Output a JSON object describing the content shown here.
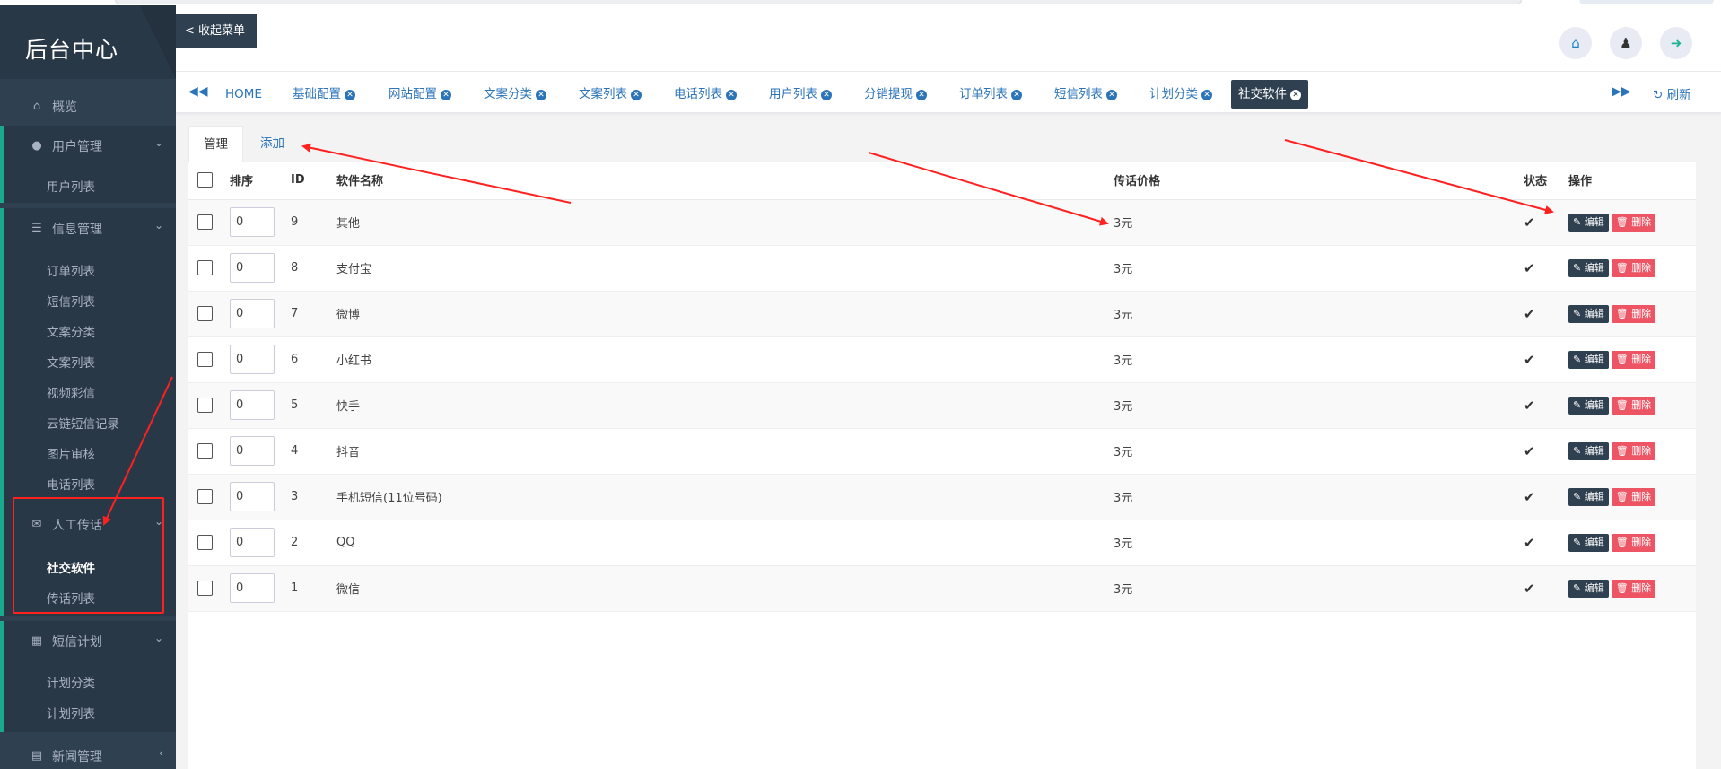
{
  "app": {
    "logo": "后台中心",
    "collapse_label": "< 收起菜单"
  },
  "sidebar": {
    "overview": "概览",
    "user_mgmt": {
      "label": "用户管理",
      "items": [
        "用户列表"
      ]
    },
    "info_mgmt": {
      "label": "信息管理",
      "items": [
        "订单列表",
        "短信列表",
        "文案分类",
        "文案列表",
        "视频彩信",
        "云链短信记录",
        "图片审核",
        "电话列表"
      ]
    },
    "manual": {
      "label": "人工传话",
      "items": [
        "社交软件",
        "传话列表"
      ],
      "active_item": "社交软件"
    },
    "sms_plan": {
      "label": "短信计划",
      "items": [
        "计划分类",
        "计划列表"
      ]
    },
    "news": {
      "label": "新闻管理"
    }
  },
  "tabs": [
    {
      "label": "HOME",
      "closable": false
    },
    {
      "label": "基础配置",
      "closable": true
    },
    {
      "label": "网站配置",
      "closable": true
    },
    {
      "label": "文案分类",
      "closable": true
    },
    {
      "label": "文案列表",
      "closable": true
    },
    {
      "label": "电话列表",
      "closable": true
    },
    {
      "label": "用户列表",
      "closable": true
    },
    {
      "label": "分销提现",
      "closable": true
    },
    {
      "label": "订单列表",
      "closable": true
    },
    {
      "label": "短信列表",
      "closable": true
    },
    {
      "label": "计划分类",
      "closable": true
    },
    {
      "label": "社交软件",
      "closable": true,
      "active": true
    }
  ],
  "tabs_refresh": "刷新",
  "subtabs": {
    "manage": "管理",
    "add": "添加"
  },
  "table": {
    "headers": {
      "sort": "排序",
      "id": "ID",
      "name": "软件名称",
      "price": "传话价格",
      "status": "状态",
      "ops": "操作"
    },
    "rows": [
      {
        "sort": "0",
        "id": "9",
        "name": "其他",
        "price": "3元"
      },
      {
        "sort": "0",
        "id": "8",
        "name": "支付宝",
        "price": "3元"
      },
      {
        "sort": "0",
        "id": "7",
        "name": "微博",
        "price": "3元"
      },
      {
        "sort": "0",
        "id": "6",
        "name": "小红书",
        "price": "3元"
      },
      {
        "sort": "0",
        "id": "5",
        "name": "快手",
        "price": "3元"
      },
      {
        "sort": "0",
        "id": "4",
        "name": "抖音",
        "price": "3元"
      },
      {
        "sort": "0",
        "id": "3",
        "name": "手机短信(11位号码)",
        "price": "3元"
      },
      {
        "sort": "0",
        "id": "2",
        "name": "QQ",
        "price": "3元"
      },
      {
        "sort": "0",
        "id": "1",
        "name": "微信",
        "price": "3元"
      }
    ],
    "edit_label": "编辑",
    "delete_label": "删除"
  },
  "colors": {
    "sidebar_bg": "#2f4050",
    "accent_green": "#19aa8d",
    "link_blue": "#2c74b8",
    "danger": "#ed5565",
    "annotation_red": "#ff2020"
  }
}
